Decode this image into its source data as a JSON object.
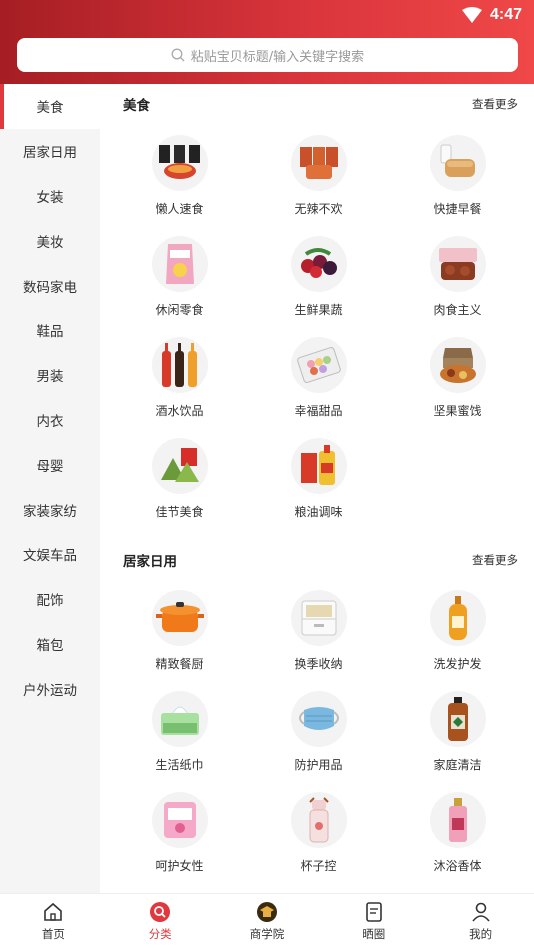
{
  "status": {
    "time": "4:47"
  },
  "search": {
    "placeholder": "粘贴宝贝标题/输入关键字搜索"
  },
  "sidebar": {
    "items": [
      "美食",
      "居家日用",
      "女装",
      "美妆",
      "数码家电",
      "鞋品",
      "男装",
      "内衣",
      "母婴",
      "家装家纺",
      "文娱车品",
      "配饰",
      "箱包",
      "户外运动"
    ],
    "active_index": 0
  },
  "sections": [
    {
      "title": "美食",
      "more": "查看更多",
      "items": [
        {
          "label": "懒人速食",
          "icon": "instant-noodle-icon"
        },
        {
          "label": "无辣不欢",
          "icon": "spicy-snack-icon"
        },
        {
          "label": "快捷早餐",
          "icon": "bread-icon"
        },
        {
          "label": "休闲零食",
          "icon": "chips-icon"
        },
        {
          "label": "生鲜果蔬",
          "icon": "berries-icon"
        },
        {
          "label": "肉食主义",
          "icon": "meat-icon"
        },
        {
          "label": "酒水饮品",
          "icon": "bottles-icon"
        },
        {
          "label": "幸福甜品",
          "icon": "macaron-icon"
        },
        {
          "label": "坚果蜜饯",
          "icon": "nuts-icon"
        },
        {
          "label": "佳节美食",
          "icon": "zongzi-icon"
        },
        {
          "label": "粮油调味",
          "icon": "oil-icon"
        }
      ]
    },
    {
      "title": "居家日用",
      "more": "查看更多",
      "items": [
        {
          "label": "精致餐厨",
          "icon": "pot-icon"
        },
        {
          "label": "换季收纳",
          "icon": "storage-drawer-icon"
        },
        {
          "label": "洗发护发",
          "icon": "shampoo-icon"
        },
        {
          "label": "生活纸巾",
          "icon": "tissue-icon"
        },
        {
          "label": "防护用品",
          "icon": "mask-icon"
        },
        {
          "label": "家庭清洁",
          "icon": "disinfectant-icon"
        },
        {
          "label": "呵护女性",
          "icon": "sanitary-pad-icon"
        },
        {
          "label": "杯子控",
          "icon": "cup-icon"
        },
        {
          "label": "沐浴香体",
          "icon": "body-spray-icon"
        }
      ]
    }
  ],
  "tabbar": {
    "items": [
      {
        "label": "首页",
        "icon": "home-icon"
      },
      {
        "label": "分类",
        "icon": "category-search-icon"
      },
      {
        "label": "商学院",
        "icon": "academy-icon"
      },
      {
        "label": "晒圈",
        "icon": "share-doc-icon"
      },
      {
        "label": "我的",
        "icon": "user-icon"
      }
    ],
    "active_index": 1
  },
  "colors": {
    "accent": "#e0383e",
    "header_start": "#a51e23",
    "header_end": "#f04848"
  }
}
